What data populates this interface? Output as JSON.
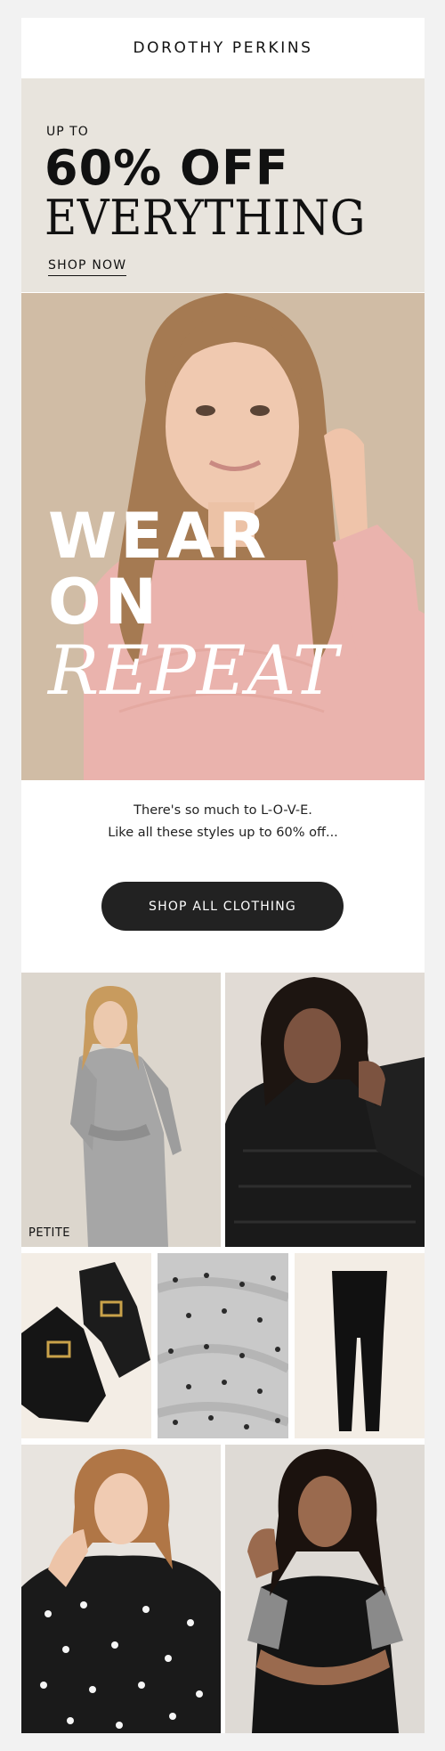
{
  "brand": {
    "logo": "DOROTHY PERKINS"
  },
  "hero": {
    "kicker": "UP TO",
    "headline_percent": "60% OFF",
    "headline_word": "EVERYTHING",
    "link_label": "SHOP NOW"
  },
  "banner": {
    "line1": "WEAR",
    "line2": "ON",
    "line3": "REPEAT"
  },
  "copy": {
    "line1": "There's so much to L-O-V-E.",
    "line2": "Like all these styles up to 60% off..."
  },
  "cta": {
    "label": "SHOP ALL CLOTHING"
  },
  "products": {
    "petite_tag": "PETITE"
  },
  "colors": {
    "hero_bg": "#e8e4dd",
    "cta_bg": "#222222",
    "text": "#111111",
    "sweater": "#eab3ad"
  }
}
